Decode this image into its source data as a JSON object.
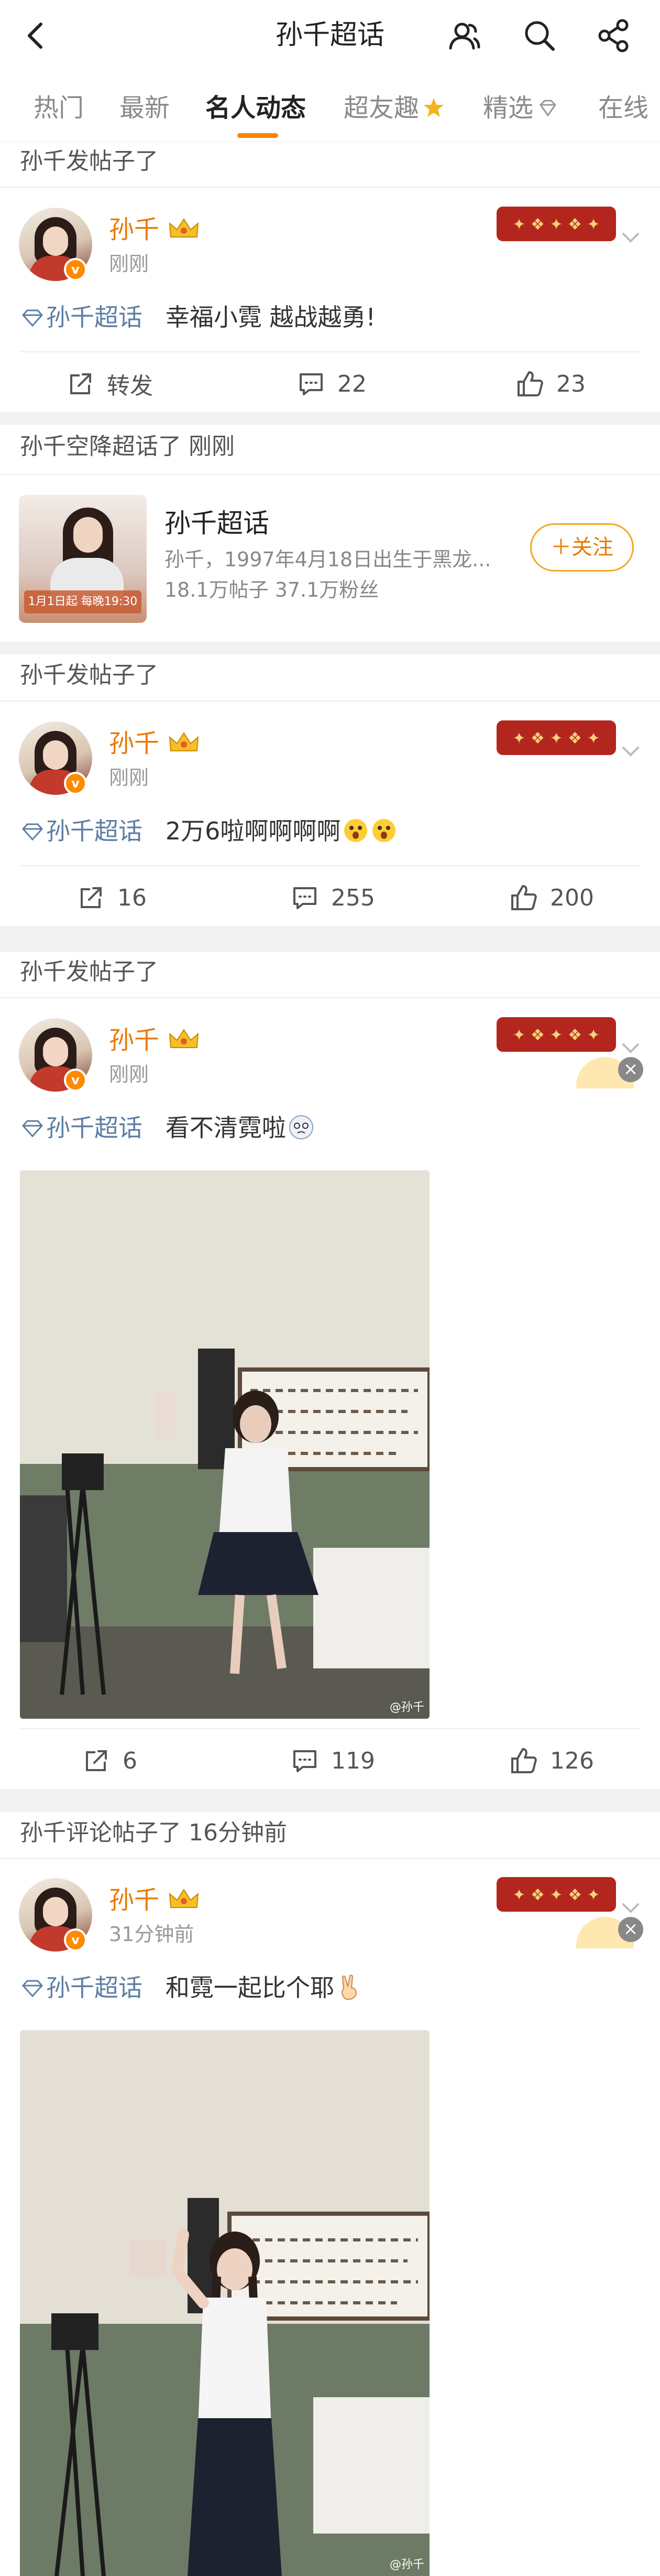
{
  "header": {
    "title": "孙千超话"
  },
  "tabs": [
    {
      "label": "热门"
    },
    {
      "label": "最新"
    },
    {
      "label": "名人动态"
    },
    {
      "label": "超友趣"
    },
    {
      "label": "精选"
    },
    {
      "label": "在线"
    }
  ],
  "colors": {
    "accent": "#ff8200",
    "username": "#eb7a00",
    "topic_tag": "#5d7ea3"
  },
  "feed": [
    {
      "kind": "post",
      "header": "孙千发帖子了",
      "author": "孙千",
      "time": "刚刚",
      "topic": "孙千超话",
      "text": "幸福小霓 越战越勇!",
      "actions": {
        "repost": "转发",
        "comments": "22",
        "likes": "23"
      }
    },
    {
      "kind": "supertopic",
      "header": "孙千空降超话了 刚刚",
      "name": "孙千超话",
      "desc": "孙千，1997年4月18日出生于黑龙...",
      "stats": "18.1万帖子  37.1万粉丝",
      "follow": "＋关注",
      "cover_text": "1月1日起 每晚19:30"
    },
    {
      "kind": "post",
      "header": "孙千发帖子了",
      "author": "孙千",
      "time": "刚刚",
      "topic": "孙千超话",
      "text": "2万6啦啊啊啊啊",
      "actions": {
        "repost": "16",
        "comments": "255",
        "likes": "200"
      }
    },
    {
      "kind": "post",
      "header": "孙千发帖子了",
      "author": "孙千",
      "time": "刚刚",
      "topic": "孙千超话",
      "text": "看不清霓啦",
      "watermark": "@孙千",
      "actions": {
        "repost": "6",
        "comments": "119",
        "likes": "126"
      }
    },
    {
      "kind": "post",
      "header": "孙千评论帖子了 16分钟前",
      "author": "孙千",
      "time": "31分钟前",
      "topic": "孙千超话",
      "text": "和霓一起比个耶",
      "watermark": "@孙千"
    }
  ]
}
